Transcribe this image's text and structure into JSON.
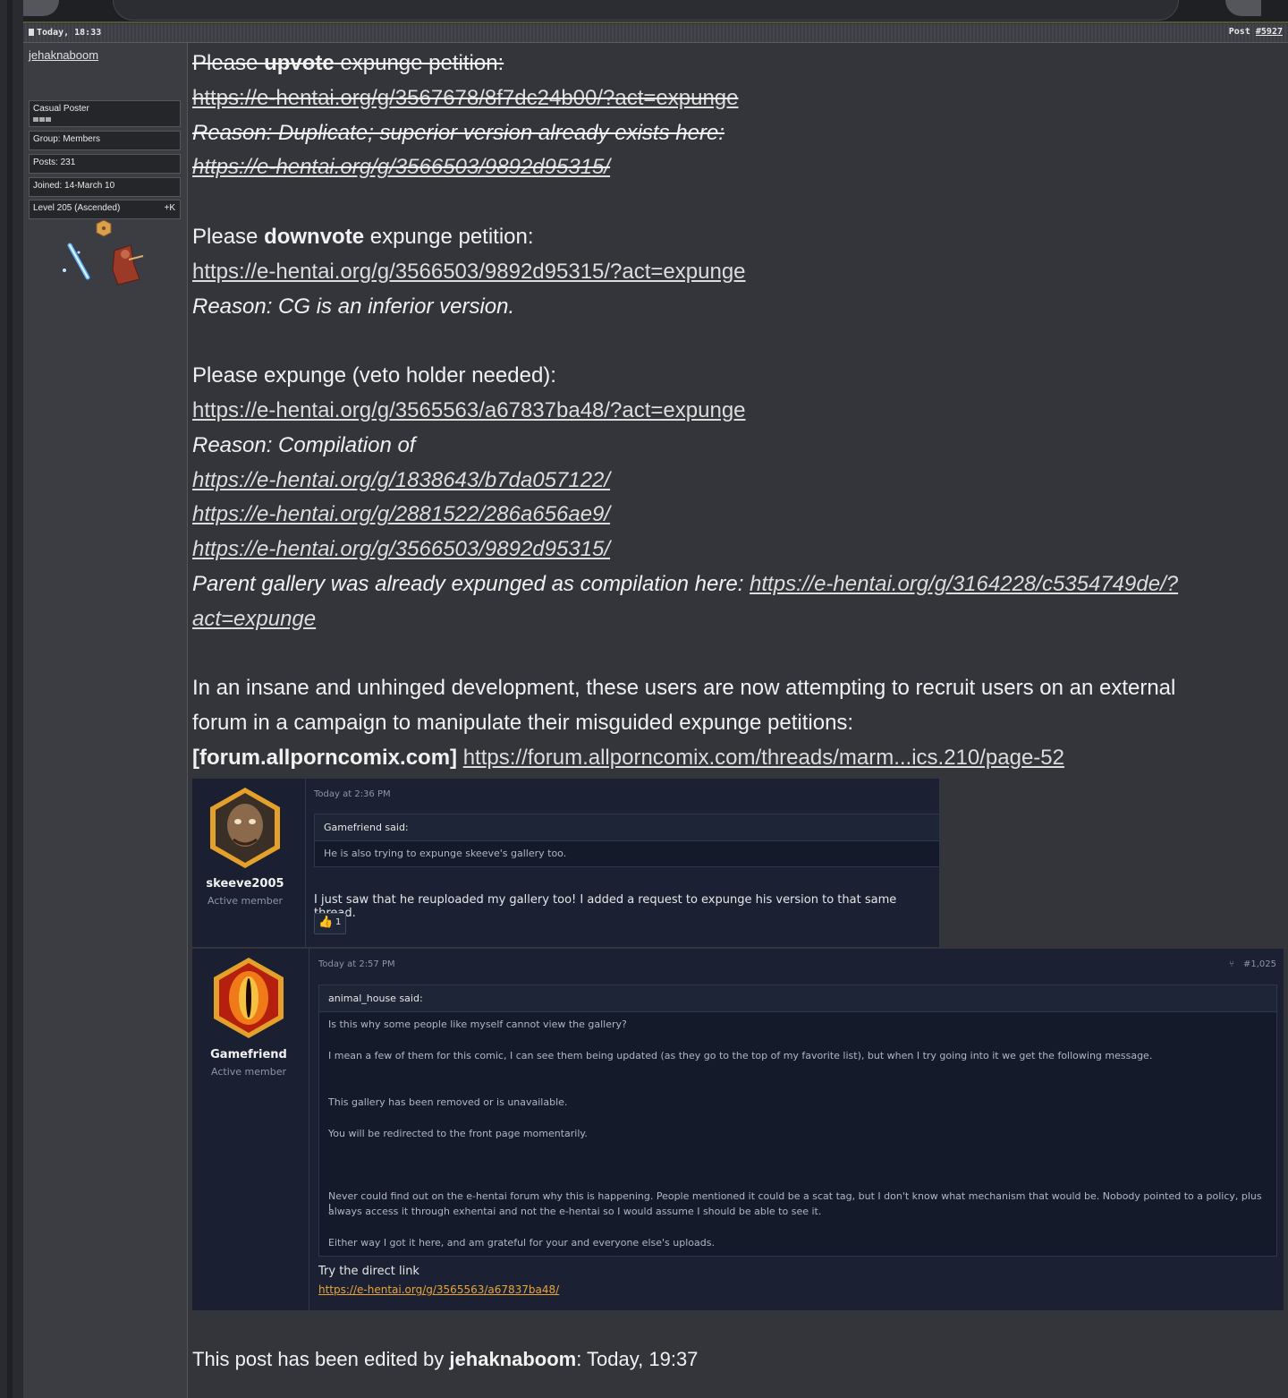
{
  "post": {
    "date": "Today, 18:33",
    "number_label": "Post",
    "number": "#5927"
  },
  "author": {
    "name": "jehaknaboom",
    "rank": "Casual Poster",
    "group": "Group: Members",
    "posts": "Posts: 231",
    "joined": "Joined: 14-March 10",
    "level": "Level 205 (Ascended)",
    "level_extra": "+K"
  },
  "body": {
    "s1_please": "Please ",
    "s1_upvote": "upvote",
    "s1_rest": " expunge petition:",
    "s1_link": "https://e-hentai.org/g/3567678/8f7dc24b00/?act=expunge",
    "s1_reason": "Reason: Duplicate; superior version already exists here:",
    "s1_link2": "https://e-hentai.org/g/3566503/9892d95315/",
    "s2_please": "Please ",
    "s2_downvote": "downvote",
    "s2_rest": " expunge petition:",
    "s2_link": "https://e-hentai.org/g/3566503/9892d95315/?act=expunge",
    "s2_reason": "Reason: CG is an inferior version.",
    "s3_title": "Please expunge (veto holder needed):",
    "s3_link": "https://e-hentai.org/g/3565563/a67837ba48/?act=expunge",
    "s3_reason": "Reason: Compilation of",
    "s3_c1": "https://e-hentai.org/g/1838643/b7da057122/",
    "s3_c2": "https://e-hentai.org/g/2881522/286a656ae9/",
    "s3_c3": "https://e-hentai.org/g/3566503/9892d95315/",
    "s3_parent": "Parent gallery was already expunged as compilation here: ",
    "s3_parent_link_a": "https://e-hentai.org/g/3164228/c5354749de/?",
    "s3_parent_link_b": "act=expunge",
    "s4_line1": "In an insane and unhinged development, these users are now attempting to recruit users on an external",
    "s4_line2": "forum in a campaign to manipulate their misguided expunge petitions:",
    "s4_tag": "[forum.allporncomix.com]",
    "s4_link": "https://forum.allporncomix.com/threads/marm...ics.210/page-52"
  },
  "shot1": {
    "member": "skeeve2005",
    "role": "Active member",
    "time": "Today at 2:36 PM",
    "quote_author": "Gamefriend said:",
    "quote_text": "He is also trying to expunge skeeve's gallery too.",
    "message": "I just saw that he reuploaded my gallery too! I added a request to expunge his version to that same thread.",
    "reaction_count": "1"
  },
  "shot2": {
    "member": "Gamefriend",
    "role": "Active member",
    "time": "Today at 2:57 PM",
    "post_no": "#1,025",
    "quote_author": "animal_house said:",
    "q1": "Is this why some people like myself cannot view the gallery?",
    "q2": "I mean a few of them for this comic, I can see them being updated (as they go to the top of my favorite list), but when I try going into it we get the following message.",
    "q3": "This gallery has been removed or is unavailable.",
    "q4": "You will be redirected to the front page momentarily.",
    "q5a": "Never could find out on the e-hentai forum why this is happening. People mentioned it could be a scat tag, but I don't know what mechanism that would be. Nobody pointed to a policy, plus I",
    "q5b": "always access it through exhentai and not the e-hentai so I would assume I should be able to see it.",
    "q6": "Either way I got it here, and am grateful for your and everyone else's uploads.",
    "message": "Try the direct link",
    "link": "https://e-hentai.org/g/3565563/a67837ba48/"
  },
  "edited": {
    "prefix": "This post has been edited by ",
    "user": "jehaknaboom",
    "suffix": ": Today, 19:37"
  },
  "colors": {
    "page_bg": "#34353b",
    "sidebar_bg": "#3c3d43",
    "text": "#f1f1f1",
    "screenshot_bg": "#1b2133",
    "screenshot_link": "#e8a43a"
  }
}
